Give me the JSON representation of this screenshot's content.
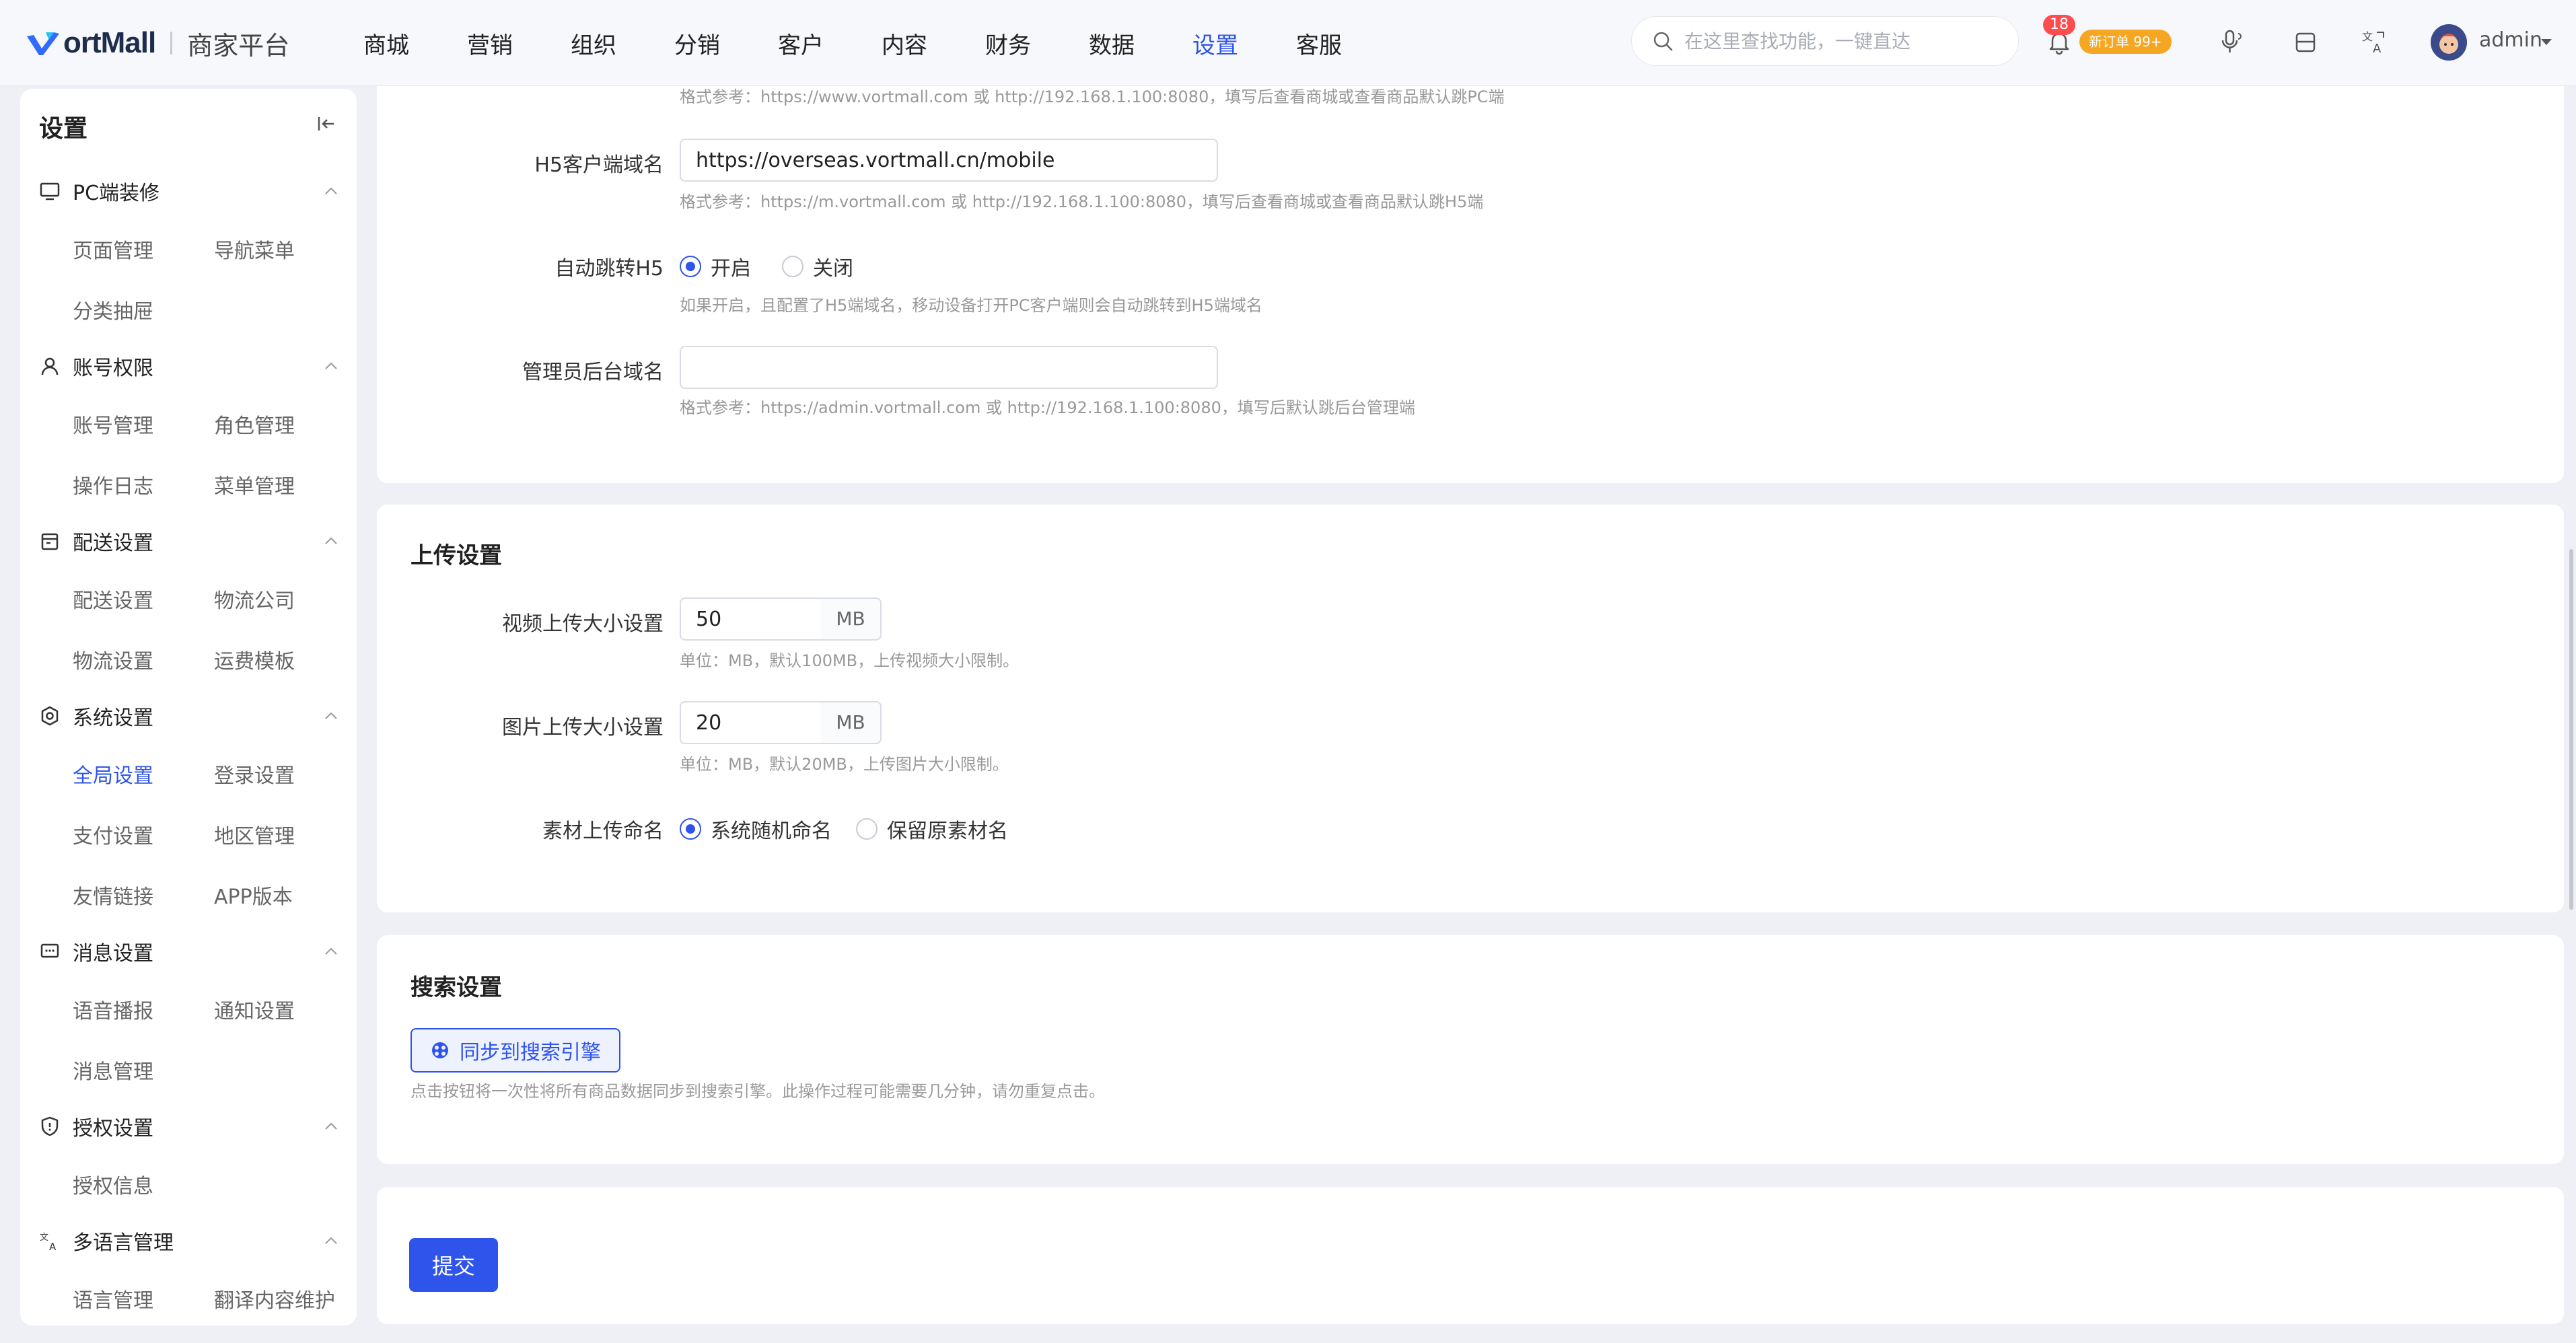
{
  "brand": {
    "logo_text": "ortMall",
    "platform": "商家平台"
  },
  "nav": [
    "商城",
    "营销",
    "组织",
    "分销",
    "客户",
    "内容",
    "财务",
    "数据",
    "设置",
    "客服"
  ],
  "nav_active": "设置",
  "search": {
    "placeholder": "在这里查找功能，一键直达"
  },
  "notifications": {
    "count": "18",
    "order_badge": "新订单 99+"
  },
  "user": {
    "name": "admin"
  },
  "sidebar": {
    "title": "设置",
    "groups": [
      {
        "label": "PC端装修",
        "icon": "monitor-icon",
        "items": [
          "页面管理",
          "导航菜单",
          "分类抽屉"
        ]
      },
      {
        "label": "账号权限",
        "icon": "user-icon",
        "items": [
          "账号管理",
          "角色管理",
          "操作日志",
          "菜单管理"
        ]
      },
      {
        "label": "配送设置",
        "icon": "box-icon",
        "items": [
          "配送设置",
          "物流公司",
          "物流设置",
          "运费模板"
        ]
      },
      {
        "label": "系统设置",
        "icon": "gear-icon",
        "items": [
          "全局设置",
          "登录设置",
          "支付设置",
          "地区管理",
          "友情链接",
          "APP版本"
        ]
      },
      {
        "label": "消息设置",
        "icon": "message-icon",
        "items": [
          "语音播报",
          "通知设置",
          "消息管理"
        ]
      },
      {
        "label": "授权设置",
        "icon": "shield-icon",
        "items": [
          "授权信息"
        ]
      },
      {
        "label": "多语言管理",
        "icon": "translate-icon",
        "items": [
          "语言管理",
          "翻译内容维护"
        ]
      }
    ],
    "active_item": "全局设置"
  },
  "domain_section": {
    "pc_hint": "格式参考：https://www.vortmall.com 或 http://192.168.1.100:8080，填写后查看商城或查看商品默认跳PC端",
    "h5_label": "H5客户端域名",
    "h5_value": "https://overseas.vortmall.cn/mobile",
    "h5_hint": "格式参考：https://m.vortmall.com 或 http://192.168.1.100:8080，填写后查看商城或查看商品默认跳H5端",
    "redirect_label": "自动跳转H5",
    "redirect_options": [
      "开启",
      "关闭"
    ],
    "redirect_selected": "开启",
    "redirect_hint": "如果开启，且配置了H5端域名，移动设备打开PC客户端则会自动跳转到H5端域名",
    "admin_label": "管理员后台域名",
    "admin_value": "",
    "admin_hint": "格式参考：https://admin.vortmall.com 或 http://192.168.1.100:8080，填写后默认跳后台管理端"
  },
  "upload_section": {
    "title": "上传设置",
    "video_label": "视频上传大小设置",
    "video_value": "50",
    "video_unit": "MB",
    "video_hint": "单位：MB，默认100MB，上传视频大小限制。",
    "image_label": "图片上传大小设置",
    "image_value": "20",
    "image_unit": "MB",
    "image_hint": "单位：MB，默认20MB，上传图片大小限制。",
    "naming_label": "素材上传命名",
    "naming_options": [
      "系统随机命名",
      "保留原素材名"
    ],
    "naming_selected": "系统随机命名"
  },
  "search_section": {
    "title": "搜索设置",
    "sync_button": "同步到搜索引擎",
    "sync_hint": "点击按钮将一次性将所有商品数据同步到搜索引擎。此操作过程可能需要几分钟，请勿重复点击。"
  },
  "submit_label": "提交",
  "colors": {
    "accent": "#2f54eb",
    "badge_red": "#ff4d4f",
    "badge_orange": "#f5a623"
  }
}
